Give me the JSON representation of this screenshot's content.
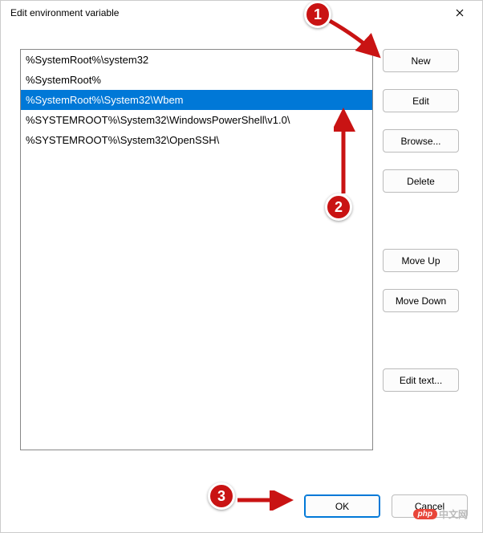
{
  "window": {
    "title": "Edit environment variable"
  },
  "list": {
    "items": [
      {
        "text": "%SystemRoot%\\system32",
        "selected": false
      },
      {
        "text": "%SystemRoot%",
        "selected": false
      },
      {
        "text": "%SystemRoot%\\System32\\Wbem",
        "selected": true
      },
      {
        "text": "%SYSTEMROOT%\\System32\\WindowsPowerShell\\v1.0\\",
        "selected": false
      },
      {
        "text": "%SYSTEMROOT%\\System32\\OpenSSH\\",
        "selected": false
      }
    ]
  },
  "buttons": {
    "new": "New",
    "edit": "Edit",
    "browse": "Browse...",
    "delete": "Delete",
    "moveUp": "Move Up",
    "moveDown": "Move Down",
    "editText": "Edit text...",
    "ok": "OK",
    "cancel": "Cancel"
  },
  "annotations": {
    "badge1": "1",
    "badge2": "2",
    "badge3": "3"
  },
  "watermark": {
    "badge": "php",
    "text": "中文网"
  }
}
